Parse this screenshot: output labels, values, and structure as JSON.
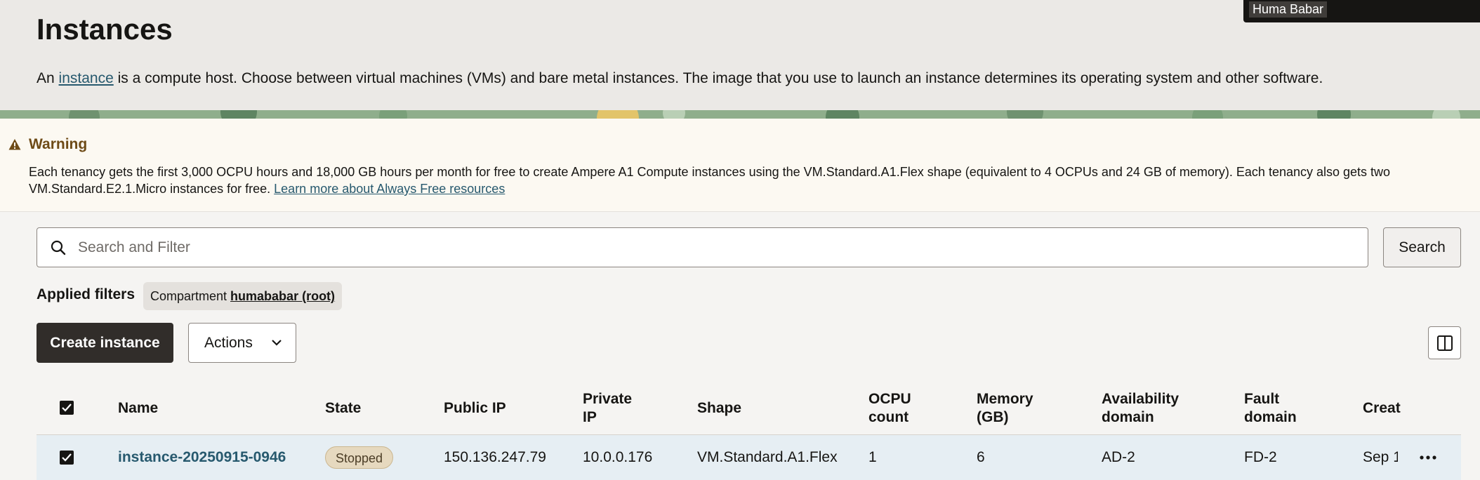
{
  "header": {
    "title": "Instances",
    "intro_before": "An ",
    "intro_link": "instance",
    "intro_after": " is a compute host. Choose between virtual machines (VMs) and bare metal instances. The image that you use to launch an instance determines its operating system and other software.",
    "user_name": "Huma Babar"
  },
  "warning": {
    "title": "Warning",
    "text": "Each tenancy gets the first 3,000 OCPU hours and 18,000 GB hours per month for free to create Ampere A1 Compute instances using the VM.Standard.A1.Flex shape (equivalent to 4 OCPUs and 24 GB of memory). Each tenancy also gets two VM.Standard.E2.1.Micro instances for free. ",
    "link": "Learn more about Always Free resources",
    "icon": "warning-triangle-icon"
  },
  "search": {
    "placeholder": "Search and Filter",
    "value": "",
    "button_label": "Search"
  },
  "filters": {
    "label": "Applied filters",
    "chip_prefix": "Compartment ",
    "chip_value": "humababar (root)"
  },
  "toolbar": {
    "create_label": "Create instance",
    "actions_label": "Actions"
  },
  "table": {
    "columns": [
      {
        "line1": "Name",
        "line2": ""
      },
      {
        "line1": "State",
        "line2": ""
      },
      {
        "line1": "Public IP",
        "line2": ""
      },
      {
        "line1": "Private",
        "line2": "IP"
      },
      {
        "line1": "Shape",
        "line2": ""
      },
      {
        "line1": "OCPU",
        "line2": "count"
      },
      {
        "line1": "Memory",
        "line2": "(GB)"
      },
      {
        "line1": "Availability",
        "line2": "domain"
      },
      {
        "line1": "Fault",
        "line2": "domain"
      },
      {
        "line1": "Creat",
        "line2": ""
      }
    ],
    "rows": [
      {
        "name": "instance-20250915-0946",
        "state": "Stopped",
        "public_ip": "150.136.247.79",
        "private_ip": "10.0.0.176",
        "shape": "VM.Standard.A1.Flex",
        "ocpu": "1",
        "memory": "6",
        "availability_domain": "AD-2",
        "fault_domain": "FD-2",
        "created": "Sep 1"
      }
    ]
  },
  "colors": {
    "primary_button": "#312d2a",
    "link": "#27596e",
    "selected_row": "#e6eef3",
    "warning_title": "#6e4b17"
  }
}
